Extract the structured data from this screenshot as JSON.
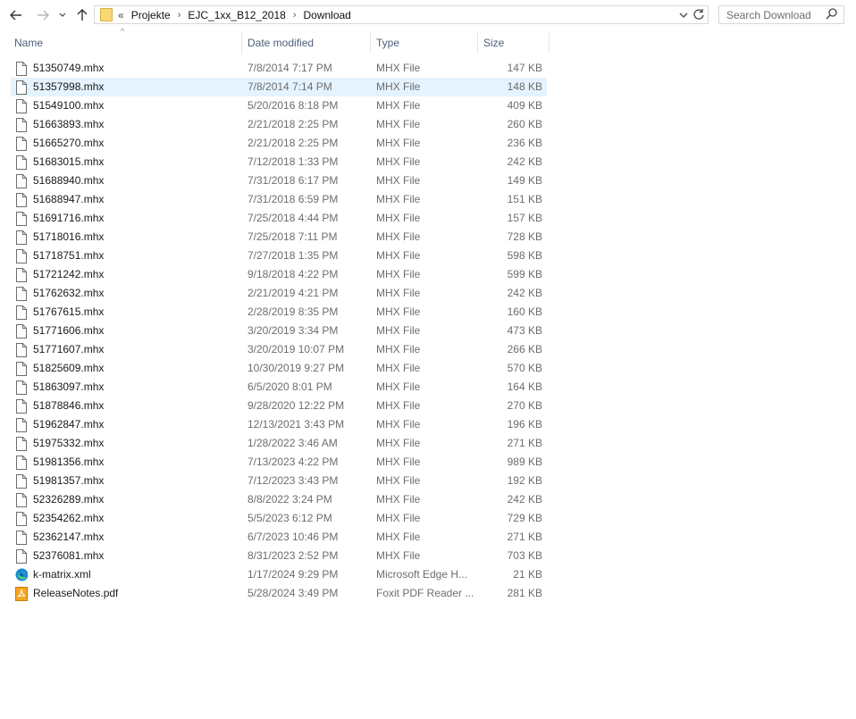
{
  "toolbar": {
    "breadcrumb": [
      "Projekte",
      "EJC_1xx_B12_2018",
      "Download"
    ],
    "overflow": "«",
    "search_placeholder": "Search Download"
  },
  "columns": {
    "name": "Name",
    "date": "Date modified",
    "type": "Type",
    "size": "Size"
  },
  "selected_index": 1,
  "files": [
    {
      "name": "51350749.mhx",
      "date": "7/8/2014 7:17 PM",
      "type": "MHX File",
      "size": "147 KB",
      "icon": "generic-file-icon"
    },
    {
      "name": "51357998.mhx",
      "date": "7/8/2014 7:14 PM",
      "type": "MHX File",
      "size": "148 KB",
      "icon": "generic-file-icon"
    },
    {
      "name": "51549100.mhx",
      "date": "5/20/2016 8:18 PM",
      "type": "MHX File",
      "size": "409 KB",
      "icon": "generic-file-icon"
    },
    {
      "name": "51663893.mhx",
      "date": "2/21/2018 2:25 PM",
      "type": "MHX File",
      "size": "260 KB",
      "icon": "generic-file-icon"
    },
    {
      "name": "51665270.mhx",
      "date": "2/21/2018 2:25 PM",
      "type": "MHX File",
      "size": "236 KB",
      "icon": "generic-file-icon"
    },
    {
      "name": "51683015.mhx",
      "date": "7/12/2018 1:33 PM",
      "type": "MHX File",
      "size": "242 KB",
      "icon": "generic-file-icon"
    },
    {
      "name": "51688940.mhx",
      "date": "7/31/2018 6:17 PM",
      "type": "MHX File",
      "size": "149 KB",
      "icon": "generic-file-icon"
    },
    {
      "name": "51688947.mhx",
      "date": "7/31/2018 6:59 PM",
      "type": "MHX File",
      "size": "151 KB",
      "icon": "generic-file-icon"
    },
    {
      "name": "51691716.mhx",
      "date": "7/25/2018 4:44 PM",
      "type": "MHX File",
      "size": "157 KB",
      "icon": "generic-file-icon"
    },
    {
      "name": "51718016.mhx",
      "date": "7/25/2018 7:11 PM",
      "type": "MHX File",
      "size": "728 KB",
      "icon": "generic-file-icon"
    },
    {
      "name": "51718751.mhx",
      "date": "7/27/2018 1:35 PM",
      "type": "MHX File",
      "size": "598 KB",
      "icon": "generic-file-icon"
    },
    {
      "name": "51721242.mhx",
      "date": "9/18/2018 4:22 PM",
      "type": "MHX File",
      "size": "599 KB",
      "icon": "generic-file-icon"
    },
    {
      "name": "51762632.mhx",
      "date": "2/21/2019 4:21 PM",
      "type": "MHX File",
      "size": "242 KB",
      "icon": "generic-file-icon"
    },
    {
      "name": "51767615.mhx",
      "date": "2/28/2019 8:35 PM",
      "type": "MHX File",
      "size": "160 KB",
      "icon": "generic-file-icon"
    },
    {
      "name": "51771606.mhx",
      "date": "3/20/2019 3:34 PM",
      "type": "MHX File",
      "size": "473 KB",
      "icon": "generic-file-icon"
    },
    {
      "name": "51771607.mhx",
      "date": "3/20/2019 10:07 PM",
      "type": "MHX File",
      "size": "266 KB",
      "icon": "generic-file-icon"
    },
    {
      "name": "51825609.mhx",
      "date": "10/30/2019 9:27 PM",
      "type": "MHX File",
      "size": "570 KB",
      "icon": "generic-file-icon"
    },
    {
      "name": "51863097.mhx",
      "date": "6/5/2020 8:01 PM",
      "type": "MHX File",
      "size": "164 KB",
      "icon": "generic-file-icon"
    },
    {
      "name": "51878846.mhx",
      "date": "9/28/2020 12:22 PM",
      "type": "MHX File",
      "size": "270 KB",
      "icon": "generic-file-icon"
    },
    {
      "name": "51962847.mhx",
      "date": "12/13/2021 3:43 PM",
      "type": "MHX File",
      "size": "196 KB",
      "icon": "generic-file-icon"
    },
    {
      "name": "51975332.mhx",
      "date": "1/28/2022 3:46 AM",
      "type": "MHX File",
      "size": "271 KB",
      "icon": "generic-file-icon"
    },
    {
      "name": "51981356.mhx",
      "date": "7/13/2023 4:22 PM",
      "type": "MHX File",
      "size": "989 KB",
      "icon": "generic-file-icon"
    },
    {
      "name": "51981357.mhx",
      "date": "7/12/2023 3:43 PM",
      "type": "MHX File",
      "size": "192 KB",
      "icon": "generic-file-icon"
    },
    {
      "name": "52326289.mhx",
      "date": "8/8/2022 3:24 PM",
      "type": "MHX File",
      "size": "242 KB",
      "icon": "generic-file-icon"
    },
    {
      "name": "52354262.mhx",
      "date": "5/5/2023 6:12 PM",
      "type": "MHX File",
      "size": "729 KB",
      "icon": "generic-file-icon"
    },
    {
      "name": "52362147.mhx",
      "date": "6/7/2023 10:46 PM",
      "type": "MHX File",
      "size": "271 KB",
      "icon": "generic-file-icon"
    },
    {
      "name": "52376081.mhx",
      "date": "8/31/2023 2:52 PM",
      "type": "MHX File",
      "size": "703 KB",
      "icon": "generic-file-icon"
    },
    {
      "name": "k-matrix.xml",
      "date": "1/17/2024 9:29 PM",
      "type": "Microsoft Edge H...",
      "size": "21 KB",
      "icon": "edge-icon"
    },
    {
      "name": "ReleaseNotes.pdf",
      "date": "5/28/2024 3:49 PM",
      "type": "Foxit PDF Reader ...",
      "size": "281 KB",
      "icon": "pdf-icon"
    }
  ]
}
